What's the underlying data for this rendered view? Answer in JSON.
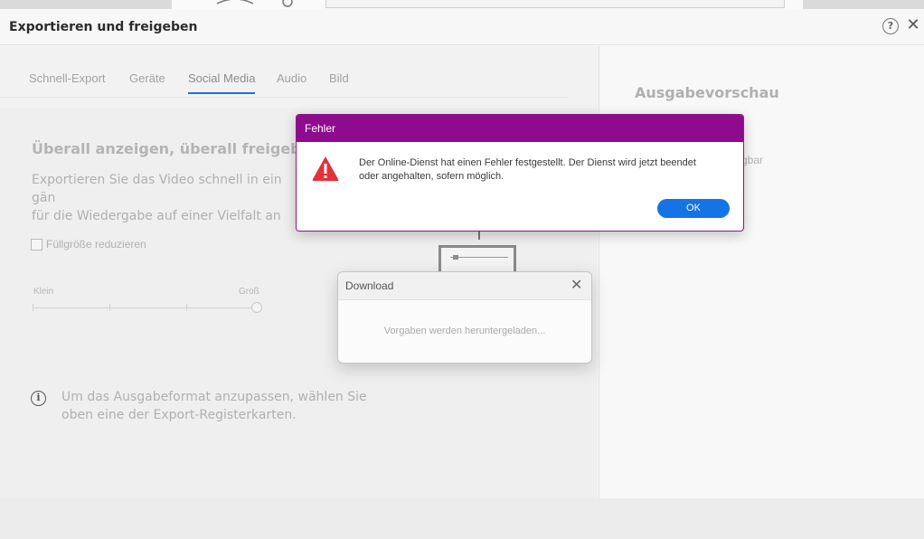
{
  "window": {
    "title": "Exportieren und freigeben",
    "help_glyph": "?",
    "close_glyph": "✕"
  },
  "tabs": [
    {
      "label": "Schnell-Export",
      "active": false
    },
    {
      "label": "Geräte",
      "active": false
    },
    {
      "label": "Social Media",
      "active": true
    },
    {
      "label": "Audio",
      "active": false
    },
    {
      "label": "Bild",
      "active": false
    }
  ],
  "main": {
    "heading": "Überall anzeigen, überall freigeben",
    "description": "Exportieren Sie das Video schnell in ein gän\nfür die Wiedergabe auf einer Vielfalt an Gerä\nWeb.",
    "checkbox_label": "Füllgröße reduzieren",
    "checkbox_checked": false,
    "slider": {
      "min_label": "Klein",
      "max_label": "Groß"
    },
    "info_glyph": "i",
    "info_text": "Um das Ausgabeformat anzupassen, wählen Sie oben eine der Export-Registerkarten."
  },
  "preview": {
    "title": "Ausgabevorschau",
    "partial_text": "gbar"
  },
  "download_dialog": {
    "title": "Download",
    "close_glyph": "✕",
    "message": "Vorgaben werden heruntergeladen..."
  },
  "error_dialog": {
    "title": "Fehler",
    "message": "Der Online-Dienst hat einen Fehler festgestellt. Der Dienst wird jetzt beendet\noder angehalten, sofern möglich.",
    "ok_label": "OK",
    "icon": "warning-triangle-icon"
  },
  "colors": {
    "accent": "#1473e6",
    "error_header": "#8e0a8e",
    "warning": "#e0333a"
  }
}
